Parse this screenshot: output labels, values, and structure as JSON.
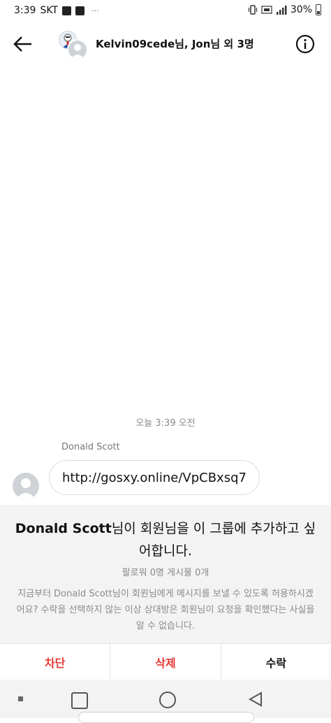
{
  "status_bar": {
    "time": "3:39",
    "carrier": "SKT",
    "battery": "30%",
    "more_indicator": "···"
  },
  "header": {
    "title": "Kelvin09cede님, Jon님 외 3명",
    "back_icon": "arrow-left-icon",
    "info_icon": "info-circle-icon"
  },
  "conversation": {
    "timestamp": "오늘 3:39 오전",
    "sender": "Donald Scott",
    "message": "http://gosxy.online/VpCBxsq7"
  },
  "request": {
    "name": "Donald Scott",
    "title_suffix": "님이 회원님을 이 그룹에 추가하고 싶어합니다.",
    "stats": "팔로워 0명 게시물 0개",
    "body": "지금부터 Donald Scott님이 회원님에게 메시지를 보낼 수 있도록 허용하시겠어요? 수락을 선택하지 않는 이상 상대방은 회원님이 요청을 확인했다는 사실을 알 수 없습니다.",
    "actions": {
      "block": "차단",
      "delete": "삭제",
      "accept": "수락"
    }
  },
  "colors": {
    "danger": "#e53935",
    "panel_bg": "#f3f3f3"
  }
}
